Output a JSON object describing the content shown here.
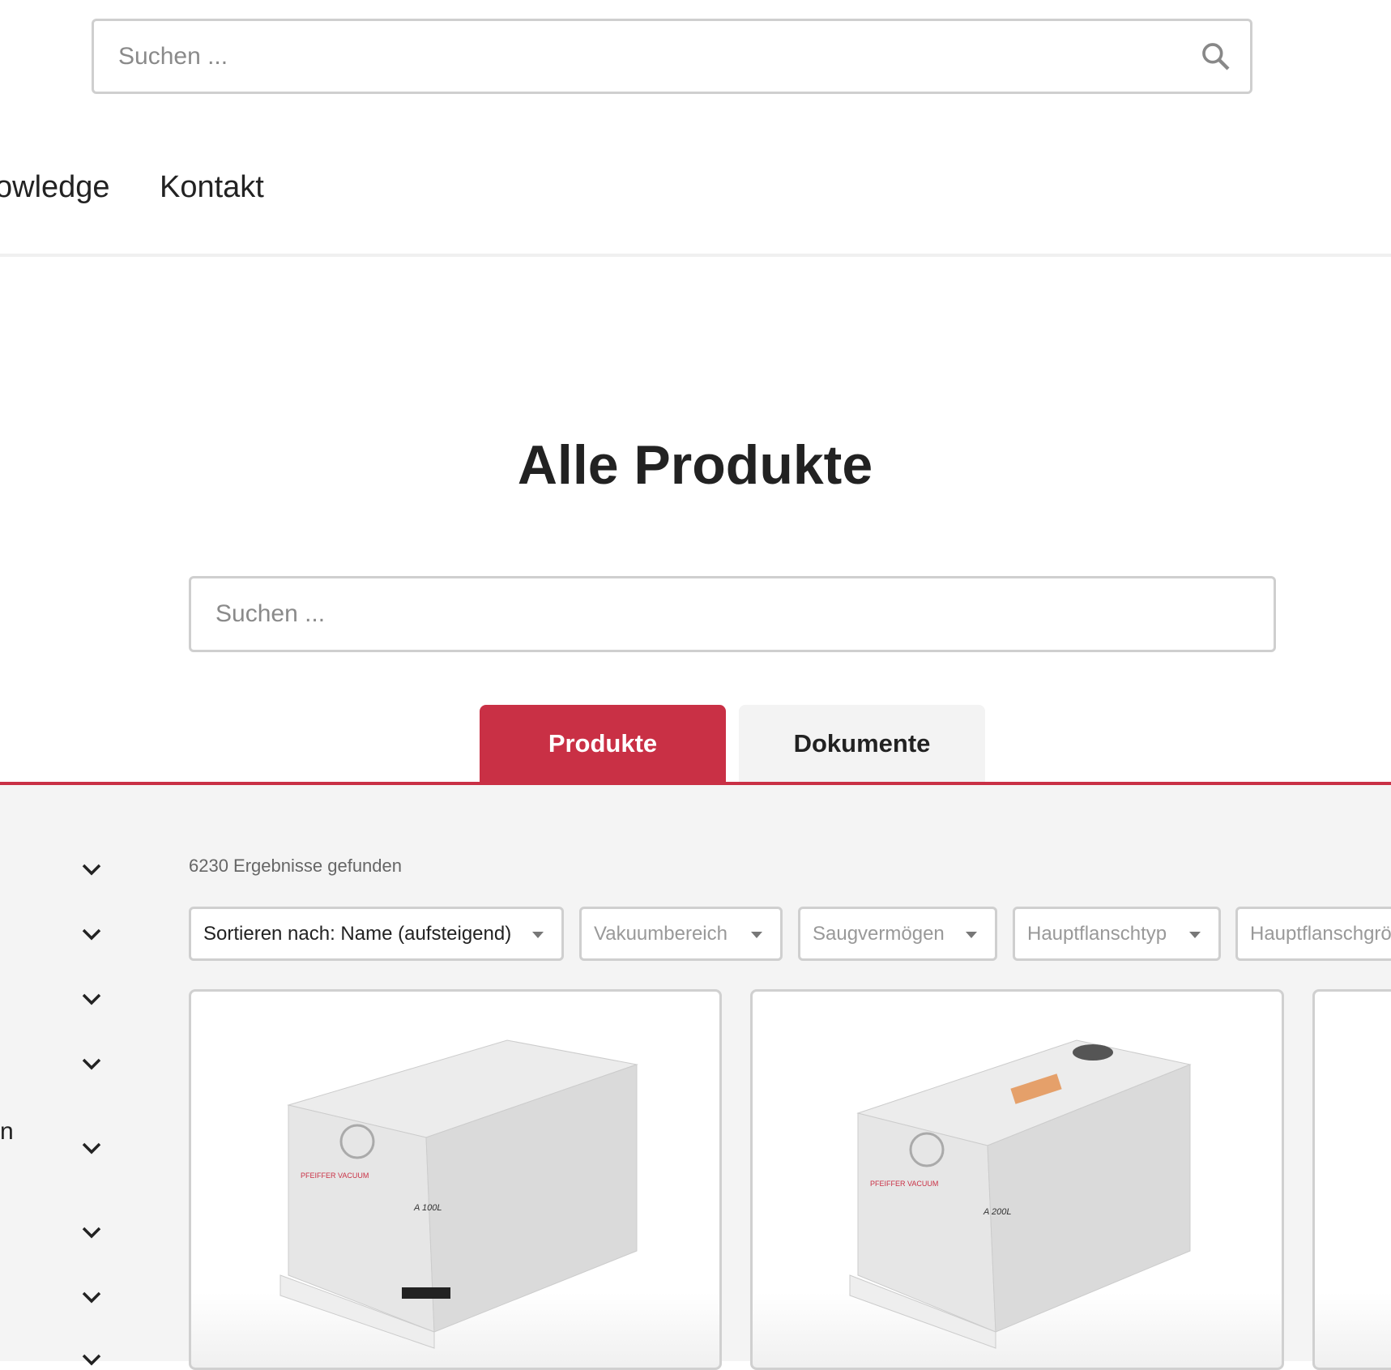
{
  "header": {
    "search_placeholder": "Suchen ...",
    "nav": [
      "owledge",
      "Kontakt"
    ]
  },
  "page": {
    "title": "Alle Produkte",
    "search_placeholder": "Suchen ...",
    "tabs": [
      "Produkte",
      "Dokumente"
    ],
    "accent": "#c93045"
  },
  "sidebar": {
    "partial_label": "n"
  },
  "results": {
    "count_text": "6230 Ergebnisse gefunden",
    "filters": [
      "Sortieren nach: Name (aufsteigend)",
      "Vakuumbereich",
      "Saugvermögen",
      "Hauptflanschtyp",
      "Hauptflanschgröße"
    ]
  },
  "products": [
    {
      "brand": "PFEIFFER VACUUM",
      "model": "A 100L"
    },
    {
      "brand": "PFEIFFER VACUUM",
      "model": "A 200L"
    }
  ]
}
